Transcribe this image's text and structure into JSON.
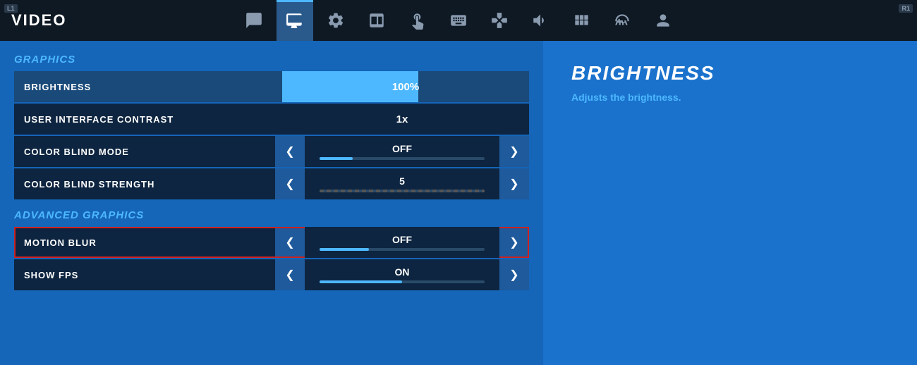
{
  "topbar": {
    "title": "VIDEO",
    "badge_l": "L1",
    "badge_r": "R1"
  },
  "nav": {
    "icons": [
      {
        "name": "chat-icon",
        "symbol": "💬",
        "active": false
      },
      {
        "name": "monitor-icon",
        "symbol": "🖥",
        "active": true
      },
      {
        "name": "gear-icon",
        "symbol": "⚙",
        "active": false
      },
      {
        "name": "display-icon",
        "symbol": "📺",
        "active": false
      },
      {
        "name": "cursor-icon",
        "symbol": "☎",
        "active": false
      },
      {
        "name": "keyboard-icon",
        "symbol": "⌨",
        "active": false
      },
      {
        "name": "controller-icon",
        "symbol": "🎮",
        "active": false
      },
      {
        "name": "audio-icon",
        "symbol": "🔊",
        "active": false
      },
      {
        "name": "grid-icon",
        "symbol": "⊞",
        "active": false
      },
      {
        "name": "gamepad-icon",
        "symbol": "🕹",
        "active": false
      },
      {
        "name": "profile-icon",
        "symbol": "👤",
        "active": false
      }
    ]
  },
  "graphics": {
    "section_title": "GRAPHICS",
    "settings": [
      {
        "label": "BRIGHTNESS",
        "type": "brightness",
        "value": "100%",
        "fill_pct": 55,
        "selected": true
      },
      {
        "label": "USER INTERFACE CONTRAST",
        "type": "text",
        "value": "1x",
        "selected": false
      },
      {
        "label": "COLOR BLIND MODE",
        "type": "arrow",
        "value": "OFF",
        "slider_pct": 20,
        "dashed": false,
        "selected": false
      },
      {
        "label": "COLOR BLIND STRENGTH",
        "type": "arrow",
        "value": "5",
        "slider_pct": 50,
        "dashed": true,
        "selected": false
      }
    ]
  },
  "advanced_graphics": {
    "section_title": "ADVANCED GRAPHICS",
    "settings": [
      {
        "label": "MOTION BLUR",
        "type": "arrow",
        "value": "OFF",
        "slider_pct": 30,
        "dashed": false,
        "highlighted": true,
        "selected": false
      },
      {
        "label": "SHOW FPS",
        "type": "arrow",
        "value": "ON",
        "slider_pct": 50,
        "dashed": false,
        "highlighted": false,
        "selected": false
      }
    ]
  },
  "right_panel": {
    "title": "BRIGHTNESS",
    "description": "Adjusts the brightness."
  },
  "arrows": {
    "left": "❮",
    "right": "❯"
  }
}
